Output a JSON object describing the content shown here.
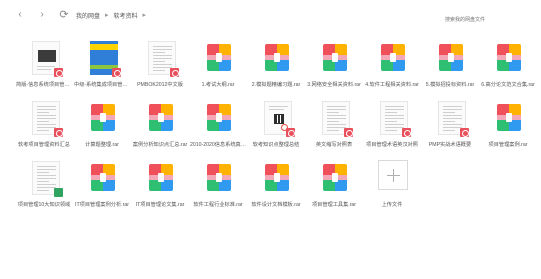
{
  "toolbar": {
    "back_icon": "‹",
    "forward_icon": "›",
    "refresh_icon": "⟳",
    "breadcrumb": [
      "我的网盘",
      "软考资料"
    ],
    "search_placeholder": "搜索我的网盘文件"
  },
  "files": [
    {
      "name": "简版-信息系统项目管理师",
      "type": "pdf",
      "thumb": "doc-dark"
    },
    {
      "name": "中级-系统集成项目管理工程师",
      "type": "pdf",
      "thumb": "doc-cover"
    },
    {
      "name": "PMBOK2012中文版",
      "type": "pdf",
      "thumb": "doc-lines"
    },
    {
      "name": "1.考试大纲.rar",
      "type": "archive"
    },
    {
      "name": "2.模拟题精编习题.rar",
      "type": "archive"
    },
    {
      "name": "3.网络安全相关资料.rar",
      "type": "archive"
    },
    {
      "name": "4.软件工程相关资料.rar",
      "type": "archive"
    },
    {
      "name": "5.模拟招投标资料.rar",
      "type": "archive"
    },
    {
      "name": "6.高分论文范文合集.rar",
      "type": "archive"
    },
    {
      "name": "软考项目管理资料汇总",
      "type": "pdf",
      "thumb": "doc-lines"
    },
    {
      "name": "计算题整理.rar",
      "type": "archive"
    },
    {
      "name": "案例分析知识点汇总.rar",
      "type": "archive"
    },
    {
      "name": "2010-2020信息系统真题.rar",
      "type": "archive"
    },
    {
      "name": "软考知识点整理总结",
      "type": "pdf",
      "thumb": "doc-qr"
    },
    {
      "name": "英文缩写对照表",
      "type": "pdf",
      "thumb": "doc-lines"
    },
    {
      "name": "项目管理术语英汉对照",
      "type": "pdf",
      "thumb": "doc-lines"
    },
    {
      "name": "PMP实战术语概要",
      "type": "pdf",
      "thumb": "doc-lines"
    },
    {
      "name": "项目管理案例.rar",
      "type": "archive"
    },
    {
      "name": "项目管理10大知识领域",
      "type": "xls",
      "thumb": "doc-lines"
    },
    {
      "name": "IT项目管理案例分析.rar",
      "type": "archive"
    },
    {
      "name": "IT项目管理论文集.rar",
      "type": "archive"
    },
    {
      "name": "软件工程行业标准.rar",
      "type": "archive"
    },
    {
      "name": "软件设计文档模板.rar",
      "type": "archive"
    },
    {
      "name": "项目管理工具集.rar",
      "type": "archive"
    }
  ],
  "upload": {
    "label": "上传文件"
  },
  "colors": {
    "archive_red": "#f0505a",
    "archive_yellow": "#ffb300",
    "archive_green": "#2fbf73",
    "archive_blue": "#2f9af0",
    "pdf_badge": "#e8505b",
    "xls_badge": "#2fa35f"
  }
}
